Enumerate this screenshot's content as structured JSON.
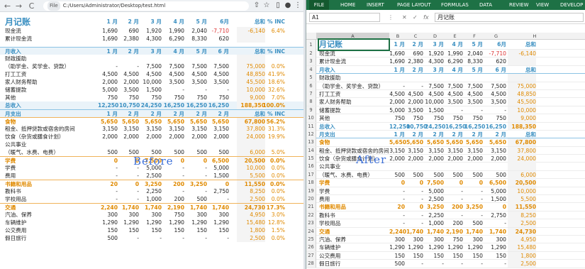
{
  "browser": {
    "back": "←",
    "forward": "→",
    "reload": "C",
    "file_label": "File",
    "path": "C:/Users/Administrator/Desktop/test.html"
  },
  "excel": {
    "tabs": [
      "FILE",
      "HOME",
      "INSERT",
      "PAGE LAYOUT",
      "FORMULAS",
      "DATA",
      "REVIEW",
      "VIEW",
      "DEVELOP"
    ],
    "cell_ref": "A1",
    "formula_value": "月记账",
    "columns": [
      "A",
      "B",
      "C",
      "D",
      "E",
      "F",
      "G",
      "H"
    ]
  },
  "overlay": {
    "before": "Before",
    "after": "After"
  },
  "colors": {
    "blue": "#3a8fc1",
    "orange": "#e08a00",
    "red": "#d33",
    "excel_green": "#1e7145"
  },
  "rows": [
    {
      "t": "title",
      "label": "月记账",
      "v": [
        "1 月",
        "2 月",
        "3 月",
        "4 月",
        "5 月",
        "6月",
        "总和",
        "% INC"
      ]
    },
    {
      "t": "n",
      "label": "现金流",
      "v": [
        "1,690",
        "690",
        "1,920",
        "1,990",
        "2,040",
        "-7,710",
        "-6,140",
        "6.4%"
      ]
    },
    {
      "t": "n",
      "label": "累计现金流",
      "v": [
        "1,690",
        "2,380",
        "4,300",
        "6,290",
        "8,330",
        "620",
        "",
        ""
      ]
    },
    {
      "t": "gap",
      "label": "",
      "v": []
    },
    {
      "t": "hb",
      "label": "月收入",
      "v": [
        "1 月",
        "2 月",
        "3 月",
        "4 月",
        "5 月",
        "6 月",
        "总和",
        "% INC"
      ]
    },
    {
      "t": "n",
      "label": "财政援助",
      "v": [
        "",
        "",
        "",
        "",
        "",
        "",
        "",
        ""
      ]
    },
    {
      "t": "n",
      "label": "（助学金、奖学金、贷款）",
      "v": [
        "-",
        "-",
        "7,500",
        "7,500",
        "7,500",
        "7,500",
        "75,000",
        "0.0%"
      ]
    },
    {
      "t": "n",
      "label": "打工工资",
      "v": [
        "4,500",
        "4,500",
        "4,500",
        "4,500",
        "4,500",
        "4,500",
        "48,850",
        "41.9%"
      ]
    },
    {
      "t": "n",
      "label": "家人财务帮助",
      "v": [
        "2,000",
        "2,000",
        "10,000",
        "3,500",
        "3,500",
        "3,500",
        "45,500",
        "18.6%"
      ]
    },
    {
      "t": "n",
      "label": "储蓄提款",
      "v": [
        "5,000",
        "3,500",
        "1,500",
        "-",
        "-",
        "-",
        "10,000",
        "32.6%"
      ]
    },
    {
      "t": "n",
      "label": "其他",
      "v": [
        "750",
        "750",
        "750",
        "750",
        "750",
        "750",
        "9,000",
        "7.0%"
      ]
    },
    {
      "t": "tb",
      "label": "总收入",
      "v": [
        "12,250",
        "10,750",
        "24,250",
        "16,250",
        "16,250",
        "16,250",
        "188,350",
        "100.0%"
      ]
    },
    {
      "t": "hb",
      "label": "月支出",
      "v": [
        "1 月",
        "2 月",
        "2 月",
        "2 月",
        "2 月",
        "2 月",
        "总和",
        "% INC"
      ]
    },
    {
      "t": "ho",
      "label": "食物",
      "v": [
        "5,650",
        "5,650",
        "5,650",
        "5,650",
        "5,650",
        "5,650",
        "67,800",
        "56.2%"
      ]
    },
    {
      "t": "n",
      "label": "租金、抵押贷款或宿舍的房间",
      "v": [
        "3,150",
        "3,150",
        "3,150",
        "3,150",
        "3,150",
        "3,150",
        "37,800",
        "31.3%"
      ]
    },
    {
      "t": "n",
      "label": "饮食（杂货或膳食计划）",
      "v": [
        "2,000",
        "2,000",
        "2,000",
        "2,000",
        "2,000",
        "2,000",
        "24,000",
        "19.9%"
      ]
    },
    {
      "t": "n",
      "label": "公共事业",
      "v": [
        "",
        "",
        "",
        "",
        "",
        "",
        "",
        ""
      ]
    },
    {
      "t": "n",
      "label": "（暖气、水费、电费）",
      "v": [
        "500",
        "500",
        "500",
        "500",
        "500",
        "500",
        "6,000",
        "5.0%"
      ]
    },
    {
      "t": "ho",
      "label": "学费",
      "v": [
        "0",
        "0",
        "7,500",
        "0",
        "0",
        "6,500",
        "20,500",
        "0.0%"
      ]
    },
    {
      "t": "n",
      "label": "学费",
      "v": [
        "-",
        "-",
        "5,000",
        "-",
        "-",
        "5,000",
        "10,000",
        "0.0%"
      ]
    },
    {
      "t": "n",
      "label": "费用",
      "v": [
        "-",
        "-",
        "2,500",
        "-",
        "-",
        "1,500",
        "5,500",
        "0.0%"
      ]
    },
    {
      "t": "ho",
      "label": "书籍和用品",
      "v": [
        "20",
        "0",
        "3,250",
        "200",
        "3,250",
        "0",
        "11,550",
        "0.0%"
      ]
    },
    {
      "t": "n",
      "label": "教科书",
      "v": [
        "-",
        "-",
        "2,250",
        "-",
        "-",
        "2,750",
        "8,250",
        "0.0%"
      ]
    },
    {
      "t": "n",
      "label": "学校用品",
      "v": [
        "-",
        "-",
        "1,000",
        "200",
        "500",
        "-",
        "2,500",
        "0.0%"
      ]
    },
    {
      "t": "ho",
      "label": "交通",
      "v": [
        "2,240",
        "1,740",
        "1,740",
        "2,190",
        "1,740",
        "1,740",
        "24,730",
        "17.3%"
      ]
    },
    {
      "t": "n",
      "label": "汽油、保养",
      "v": [
        "300",
        "300",
        "300",
        "750",
        "300",
        "300",
        "4,950",
        "3.0%"
      ]
    },
    {
      "t": "n",
      "label": "车辆维护",
      "v": [
        "1,290",
        "1,290",
        "1,290",
        "1,290",
        "1,290",
        "1,290",
        "15,480",
        "12.8%"
      ]
    },
    {
      "t": "n",
      "label": "公交费用",
      "v": [
        "150",
        "150",
        "150",
        "150",
        "150",
        "150",
        "1,800",
        "1.5%"
      ]
    },
    {
      "t": "n",
      "label": "假日旅行",
      "v": [
        "500",
        "-",
        "-",
        "-",
        "-",
        "-",
        "2,500",
        "0.0%"
      ]
    }
  ]
}
